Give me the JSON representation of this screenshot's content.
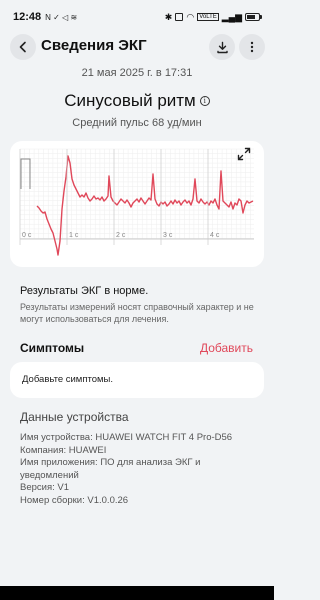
{
  "status_bar": {
    "time": "12:48",
    "icons_left": "N ✓ ◁ ≋",
    "network": "VoLTE"
  },
  "header": {
    "title": "Сведения ЭКГ",
    "back_icon": "chevron-left-icon",
    "download_icon": "download-icon",
    "more_icon": "more-vertical-icon"
  },
  "summary": {
    "datetime": "21 мая 2025 г. в 17:31",
    "rhythm": "Синусовый ритм",
    "info_symbol": "i",
    "avg_pulse": "Средний пульс 68 уд/мин"
  },
  "ecg": {
    "time_labels": [
      "0 с",
      "1 с",
      "2 с",
      "3 с",
      "4 с"
    ],
    "trace_color": "#e0485a",
    "expand_icon": "expand-icon"
  },
  "result": {
    "title": "Результаты ЭКГ в норме.",
    "disclaimer": "Результаты измерений носят справочный характер и не могут использоваться для лечения."
  },
  "symptoms": {
    "title": "Симптомы",
    "add_label": "Добавить",
    "placeholder": "Добавьте симптомы."
  },
  "device": {
    "title": "Данные устройства",
    "name": "Имя устройства: HUAWEI WATCH FIT 4 Pro-D56",
    "company": "Компания: HUAWEI",
    "app_line1": "Имя приложения: ПО для анализа ЭКГ и",
    "app_line2": "уведомлений",
    "version": "Версия: V1",
    "build": "Номер сборки: V1.0.0.26"
  },
  "colors": {
    "accent": "#e0485a",
    "background": "#f1f3f5",
    "card": "#ffffff"
  }
}
